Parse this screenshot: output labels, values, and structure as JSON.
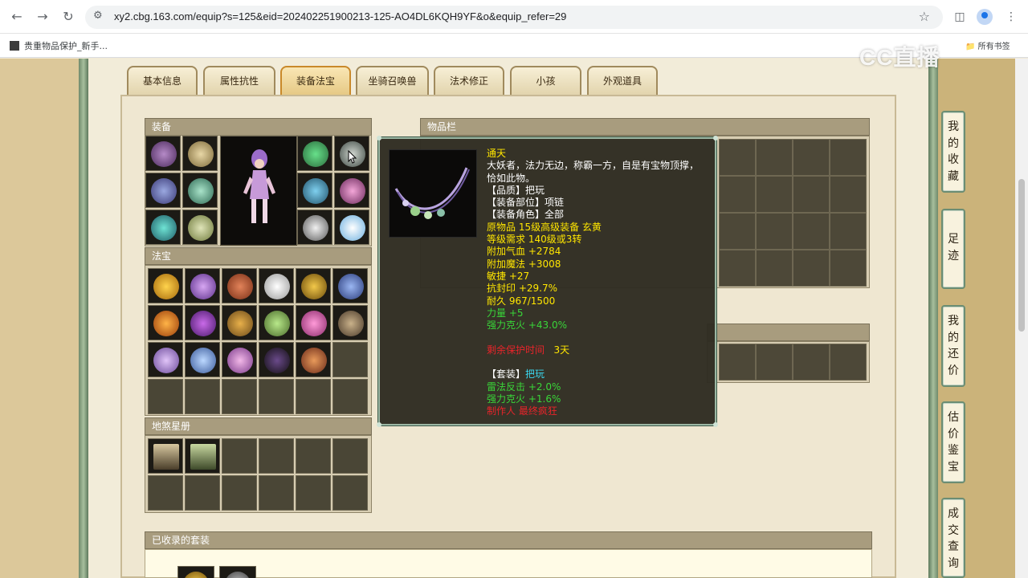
{
  "browser": {
    "url": "xy2.cbg.163.com/equip?s=125&eid=202402251900213-125-AO4DL6KQH9YF&o&equip_refer=29",
    "bookmark": "贵重物品保护_新手...",
    "all_bookmarks": "所有书签"
  },
  "watermark": "CC直播",
  "tabs": [
    "基本信息",
    "属性抗性",
    "装备法宝",
    "坐骑召唤兽",
    "法术修正",
    "小孩",
    "外观道具"
  ],
  "active_tab": "装备法宝",
  "sections": {
    "equipment": "装备",
    "fabao": "法宝",
    "disha": "地煞星册",
    "inventory": "物品栏",
    "suits": "已收录的套装"
  },
  "tooltip": {
    "name": "通天",
    "desc_line1": "大妖者，法力无边，称霸一方，自是有宝物顶撑，",
    "desc_line2": "恰如此物。",
    "quality": "【品质】把玩",
    "slot": "【装备部位】项链",
    "role": "【装备角色】全部",
    "origin": "原物品 15级高级装备 玄黄",
    "level_req": "等级需求 140级或3转",
    "hp": "附加气血 +2784",
    "mp": "附加魔法 +3008",
    "agility": "敏捷 +27",
    "anti_seal": "抗封印 +29.7%",
    "durability": "耐久 967/1500",
    "strength": "力量 +5",
    "fire": "强力克火 +43.0%",
    "protect_label": "剩余保护时间",
    "protect_value": "3天",
    "set_label": "【套装】",
    "set_value": "把玩",
    "set_bonus1": "雷法反击 +2.0%",
    "set_bonus2": "强力克火 +1.6%",
    "maker": "制作人 最终疯狂"
  },
  "right_rail": [
    [
      "我",
      "的",
      "收",
      "藏"
    ],
    [
      "足",
      "迹"
    ],
    [
      "我",
      "的",
      "还",
      "价"
    ],
    [
      "估",
      "价",
      "鉴",
      "宝"
    ],
    [
      "成",
      "交",
      "查",
      "询"
    ]
  ],
  "colors": {
    "tooltip_bg": "#302c22",
    "title_yellow": "#ffe600",
    "bonus_green": "#39d639",
    "warn_red": "#e8242a",
    "set_cyan": "#3ad8f0",
    "section_header": "#a89c7e",
    "active_tab_border": "#c9892a"
  }
}
